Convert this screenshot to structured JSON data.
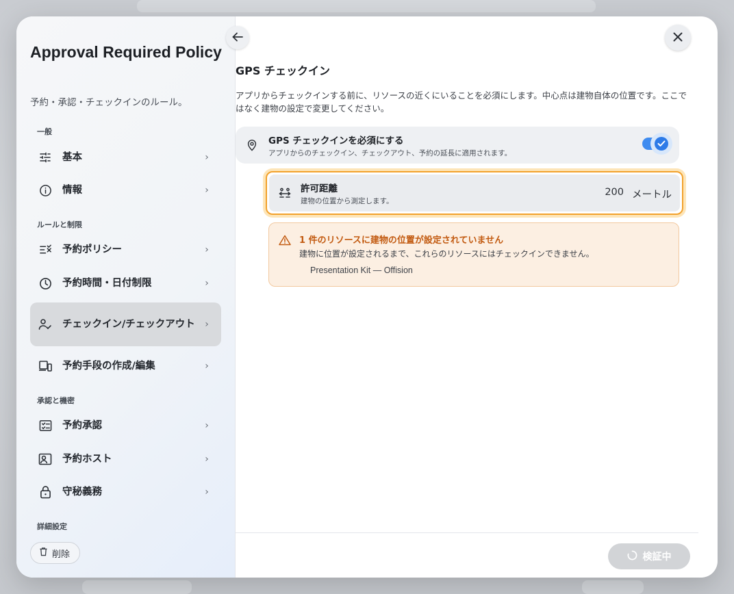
{
  "sidebar": {
    "title": "Approval Required Policy",
    "subtitle": "予約・承認・チェックインのルール。",
    "sections": {
      "general": "一般",
      "rules": "ルールと制限",
      "approval": "承認と機密",
      "advanced": "詳細設定"
    },
    "items": [
      {
        "label": "基本",
        "icon": "sliders-icon"
      },
      {
        "label": "情報",
        "icon": "info-icon"
      },
      {
        "label": "予約ポリシー",
        "icon": "policy-list-icon"
      },
      {
        "label": "予約時間・日付制限",
        "icon": "clock-icon"
      },
      {
        "label": "チェックイン/チェックアウト",
        "icon": "person-check-icon"
      },
      {
        "label": "予約手段の作成/編集",
        "icon": "devices-icon"
      },
      {
        "label": "予約承認",
        "icon": "approval-icon"
      },
      {
        "label": "予約ホスト",
        "icon": "host-icon"
      },
      {
        "label": "守秘義務",
        "icon": "lock-icon"
      }
    ],
    "active_index": 4,
    "delete_label": "削除"
  },
  "main": {
    "title": "GPS チェックイン",
    "description": "アプリからチェックインする前に、リソースの近くにいることを必須にします。中心点は建物自体の位置です。ここではなく建物の設定で変更してください。",
    "gps_toggle": {
      "label": "GPS チェックインを必須にする",
      "hint": "アプリからのチェックイン、チェックアウト、予約の延長に適用されます。",
      "enabled": true
    },
    "distance": {
      "label": "許可距離",
      "hint": "建物の位置から測定します。",
      "value": "200",
      "unit": "メートル"
    },
    "warning": {
      "title": "1 件のリソースに建物の位置が設定されていません",
      "body": "建物に位置が設定されるまで、これらのリソースにはチェックインできません。",
      "items": [
        "Presentation Kit — Offision"
      ]
    },
    "verify_button": "検証中"
  },
  "colors": {
    "accent": "#2d7be8",
    "warning_text": "#c25a10",
    "highlight_border": "#f2a12b"
  }
}
